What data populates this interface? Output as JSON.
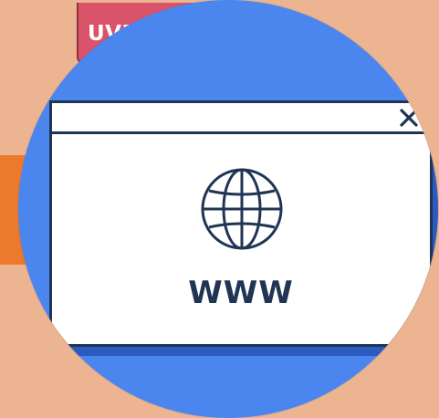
{
  "background_button": {
    "label": "UVER"
  },
  "browser_window": {
    "center_text": "WWW",
    "close_icon": "close-icon",
    "globe_icon": "globe-icon"
  },
  "colors": {
    "background": "#ecb491",
    "circle": "#4b86ee",
    "window_border": "#1f3553",
    "window_shadow": "#2c5bbf",
    "tag": "#d9546b",
    "orange": "#ec7a2d"
  }
}
